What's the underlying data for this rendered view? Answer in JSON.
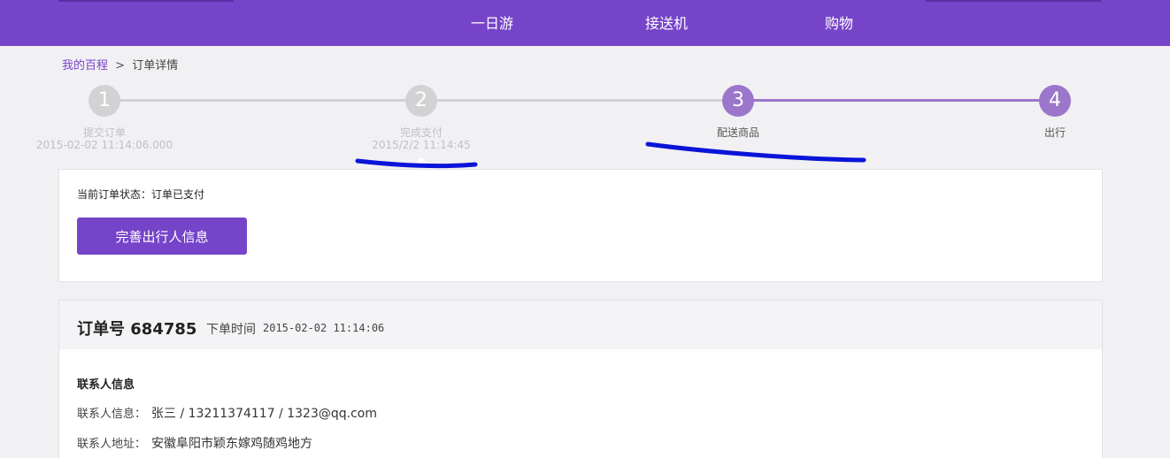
{
  "nav": {
    "items": [
      "一日游",
      "接送机",
      "购物"
    ]
  },
  "breadcrumb": {
    "home": "我的百程",
    "separator": ">",
    "current": "订单详情"
  },
  "steps": [
    {
      "number": "1",
      "label": "提交订单",
      "time": "2015-02-02 11:14:06.000",
      "state": "done"
    },
    {
      "number": "2",
      "label": "完成支付",
      "time": "2015/2/2 11:14:45",
      "state": "done"
    },
    {
      "number": "3",
      "label": "配送商品",
      "time": "",
      "state": "active"
    },
    {
      "number": "4",
      "label": "出行",
      "time": "",
      "state": "active"
    }
  ],
  "status": {
    "text": "当前订单状态：订单已支付",
    "button_label": "完善出行人信息"
  },
  "order": {
    "title": "订单号 684785",
    "time_label": "下单时间",
    "time_value": "2015-02-02 11:14:06",
    "contact_section_title": "联系人信息",
    "contact_info_label": "联系人信息：",
    "contact_info_value": "张三 / 13211374117 / 1323@qq.com",
    "contact_address_label": "联系人地址：",
    "contact_address_value": "安徽阜阳市颖东嫁鸡随鸡地方"
  },
  "colors": {
    "brand": "#7644c9",
    "step_active": "#9b76cb",
    "step_inactive": "#d2d2d4",
    "annotation": "#0a14d8"
  }
}
